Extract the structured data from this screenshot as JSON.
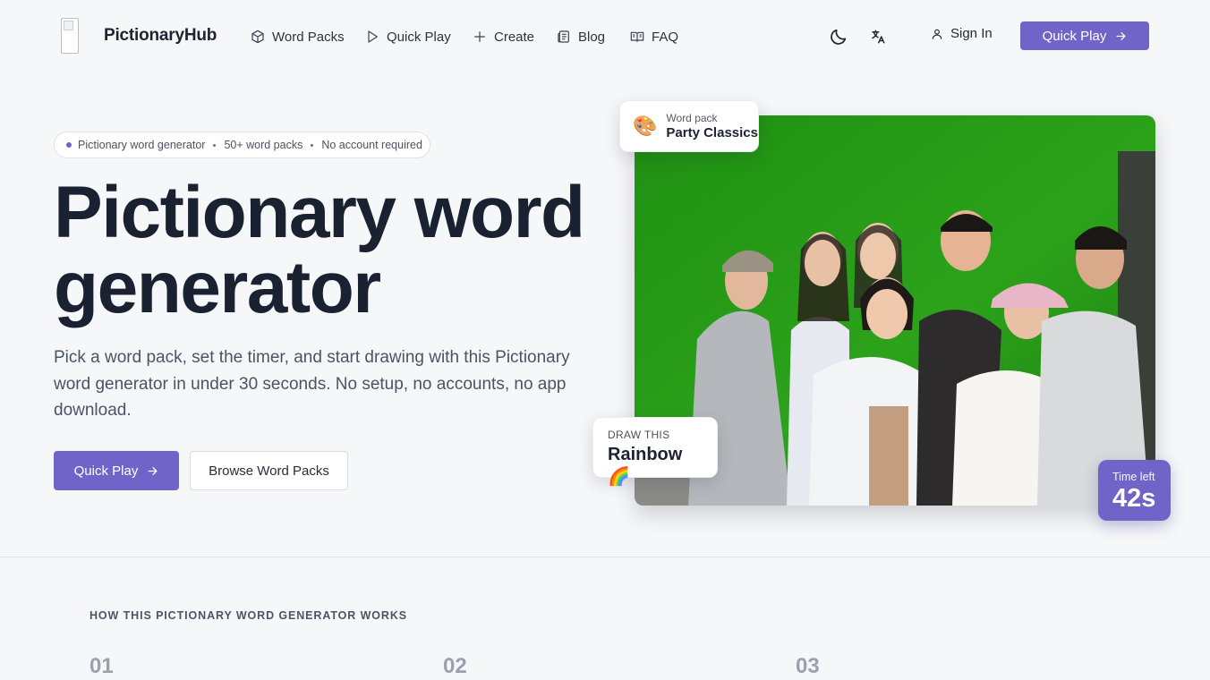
{
  "nav": {
    "brand": "PictionaryHub",
    "items": [
      {
        "label": "Word Packs",
        "icon": "cube-icon"
      },
      {
        "label": "Quick Play",
        "icon": "play-icon"
      },
      {
        "label": "Create",
        "icon": "plus-icon"
      },
      {
        "label": "Blog",
        "icon": "newspaper-icon"
      },
      {
        "label": "FAQ",
        "icon": "book-icon"
      }
    ],
    "theme_icon": "moon-icon",
    "language_icon": "translate-icon",
    "sign_in": "Sign In",
    "cta": "Quick Play"
  },
  "hero": {
    "pill": {
      "items": [
        "Pictionary word generator",
        "50+ word packs",
        "No account required"
      ]
    },
    "title": "Pictionary word generator",
    "subtitle": "Pick a word pack, set the timer, and start drawing with this Pictionary word generator in under 30 seconds. No setup, no accounts, no app download.",
    "primary_cta": "Quick Play",
    "secondary_cta": "Browse Word Packs"
  },
  "showcase": {
    "pack_card": {
      "emoji": "🎨",
      "label": "Word pack",
      "value": "Party Classics"
    },
    "draw_card": {
      "label": "DRAW THIS",
      "value": "Rainbow 🌈"
    },
    "timer": {
      "label": "Time left",
      "value": "42s"
    }
  },
  "how_it_works": {
    "title": "HOW THIS PICTIONARY WORD GENERATOR WORKS",
    "steps": [
      "01",
      "02",
      "03"
    ]
  },
  "colors": {
    "accent": "#7164c8",
    "background": "#f6f7f9",
    "text": "#1a2130",
    "photo_backdrop": "#2f9a1c"
  }
}
